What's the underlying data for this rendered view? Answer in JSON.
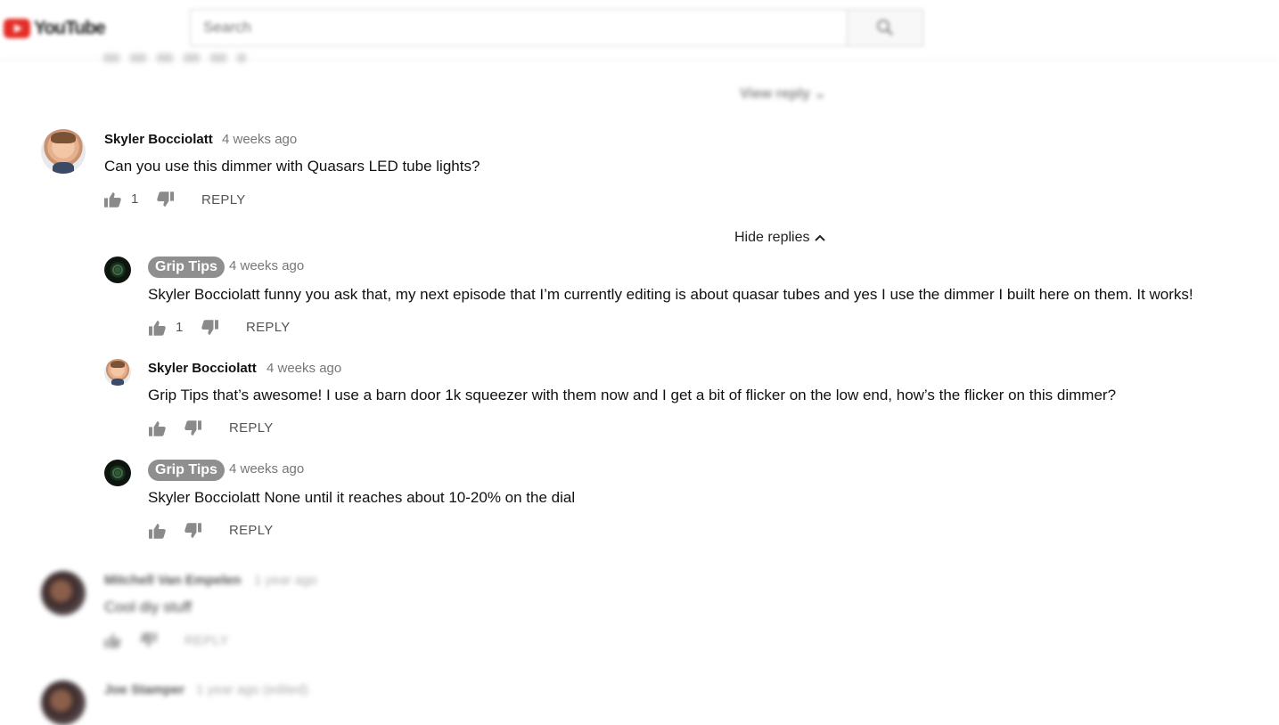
{
  "header": {
    "logo_text": "YouTube",
    "search_placeholder": "Search"
  },
  "prev_thread": {
    "view_reply_label": "View reply"
  },
  "thread": {
    "comment": {
      "author": "Skyler Bocciolatt",
      "time": "4 weeks ago",
      "text": "Can you use this dimmer with Quasars LED tube lights?",
      "likes": "1",
      "reply_label": "REPLY"
    },
    "hide_replies_label": "Hide replies",
    "replies": [
      {
        "author": "Grip Tips",
        "time": "4 weeks ago",
        "text": "Skyler Bocciolatt funny you ask that, my next episode that I’m currently editing is about quasar tubes and yes I use the dimmer I built here on them. It works!",
        "likes": "1",
        "reply_label": "REPLY"
      },
      {
        "author": "Skyler Bocciolatt",
        "time": "4 weeks ago",
        "text": "Grip Tips that’s awesome! I use a barn door 1k squeezer with them now and I get a bit of flicker on the low end, how’s the flicker on this dimmer?",
        "likes": "",
        "reply_label": "REPLY"
      },
      {
        "author": "Grip Tips",
        "time": "4 weeks ago",
        "text": "Skyler Bocciolatt None until it reaches about 10-20% on the dial",
        "likes": "",
        "reply_label": "REPLY"
      }
    ]
  },
  "next_comments": [
    {
      "author": "Mitchell Van Empelen",
      "time": "1 year ago",
      "text": "Cool diy stuff",
      "reply_label": "REPLY"
    },
    {
      "author": "Joe Stamper",
      "time": "1 year ago (edited)"
    }
  ],
  "icons": {
    "like": "thumbs-up-icon",
    "dislike": "thumbs-down-icon",
    "chevron": "chevron-up-icon",
    "search": "search-icon"
  },
  "colors": {
    "creator_badge": "#8f8f8f",
    "logo_red": "#e52d27"
  }
}
